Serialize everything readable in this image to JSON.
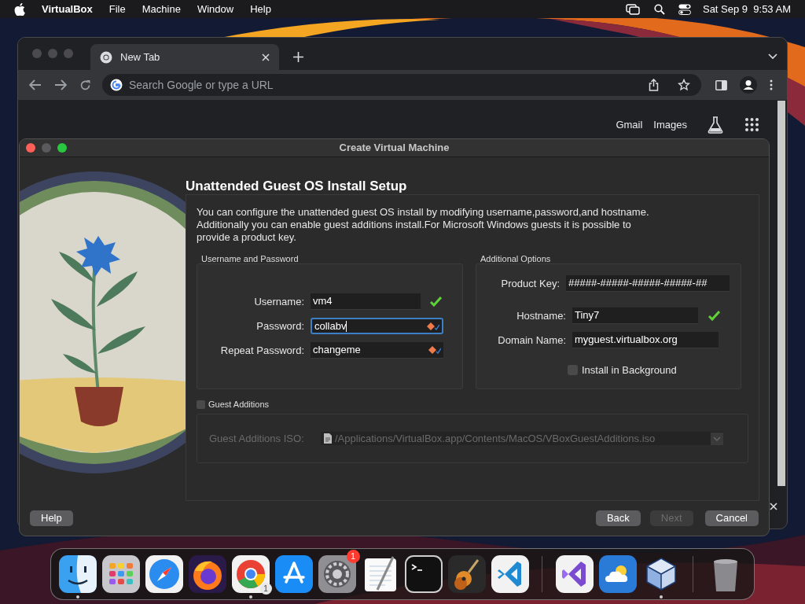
{
  "menu_bar": {
    "app": "VirtualBox",
    "menus": [
      "File",
      "Machine",
      "Window",
      "Help"
    ],
    "clock": "Sat Sep 9  9:53 AM"
  },
  "browser": {
    "tab": {
      "title": "New Tab",
      "selected": true
    },
    "omnibox": {
      "placeholder": "Search Google or type a URL"
    },
    "links": [
      "Gmail",
      "Images"
    ]
  },
  "dialog": {
    "title": "Create Virtual Machine",
    "heading": "Unattended Guest OS Install Setup",
    "description": "You can configure the unattended guest OS install by modifying username,password,and hostname. Additionally you can enable guest additions install.For Microsoft Windows guests it is possible to provide a product key.",
    "username_password": {
      "title": "Username and Password",
      "fields": [
        {
          "label": "Username:",
          "value": "vm4",
          "focused": false,
          "valid": true
        },
        {
          "label": "Password:",
          "value": "collabv",
          "focused": true,
          "valid": false
        },
        {
          "label": "Repeat Password:",
          "value": "changeme",
          "focused": false,
          "valid": false
        }
      ]
    },
    "additional_options": {
      "title": "Additional Options",
      "fields": [
        {
          "label": "Product Key:",
          "value": "#####-#####-#####-#####-##"
        },
        {
          "label": "Hostname:",
          "value": "Tiny7",
          "valid": true
        },
        {
          "label": "Domain Name:",
          "value": "myguest.virtualbox.org"
        }
      ],
      "install_in_background": {
        "label": "Install in Background",
        "checked": false
      }
    },
    "guest_additions": {
      "label": "Guest Additions",
      "checked": false,
      "iso_label": "Guest Additions ISO:",
      "iso_path": "/Applications/VirtualBox.app/Contents/MacOS/VBoxGuestAdditions.iso"
    },
    "buttons": [
      {
        "label": "Help",
        "disabled": false
      },
      {
        "label": "Back",
        "disabled": false
      },
      {
        "label": "Next",
        "disabled": true
      },
      {
        "label": "Cancel",
        "disabled": false
      }
    ]
  },
  "dock": [
    {
      "kind": "finder",
      "running": true
    },
    {
      "kind": "launchpad",
      "running": false
    },
    {
      "kind": "safari",
      "running": false
    },
    {
      "kind": "firefox",
      "running": false
    },
    {
      "kind": "chrome",
      "running": true,
      "sub_badge": "1"
    },
    {
      "kind": "appstore",
      "running": false
    },
    {
      "kind": "settings",
      "running": false,
      "badge": "1"
    },
    {
      "kind": "textedit",
      "running": false
    },
    {
      "kind": "terminal",
      "running": false
    },
    {
      "kind": "garageband",
      "running": false
    },
    {
      "kind": "vscode",
      "running": false
    },
    {
      "kind": "separator"
    },
    {
      "kind": "visualstudio",
      "running": false
    },
    {
      "kind": "weather",
      "running": false
    },
    {
      "kind": "virtualbox",
      "running": true
    },
    {
      "kind": "separator"
    },
    {
      "kind": "trash",
      "running": false
    }
  ]
}
